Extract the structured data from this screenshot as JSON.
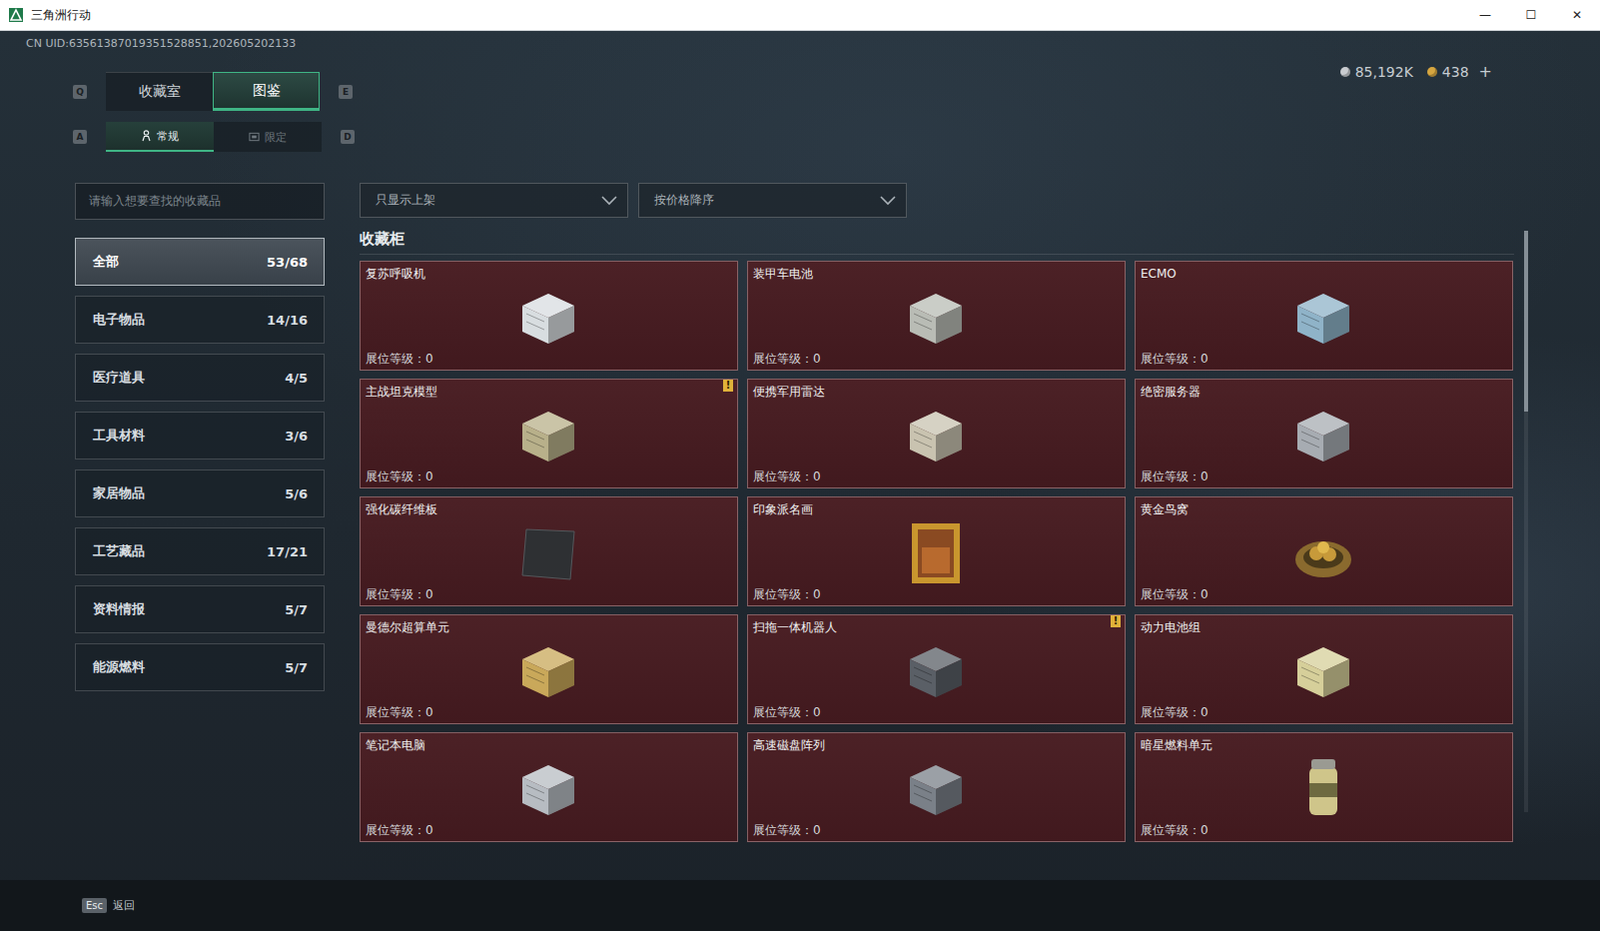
{
  "window": {
    "title": "三角洲行动",
    "controls": [
      "—",
      "☐",
      "✕"
    ]
  },
  "uid": "CN UID:63561387019351528851,202605202133",
  "currency": [
    {
      "amount": "85,192K",
      "color": "#c9ccd0"
    },
    {
      "amount": "438",
      "color": "#d6a640"
    }
  ],
  "add_button": "+",
  "main_tabs": {
    "prev_key": "Q",
    "next_key": "E",
    "tabs": [
      {
        "label": "收藏室",
        "selected": false
      },
      {
        "label": "图鉴",
        "selected": true
      }
    ]
  },
  "sub_tabs": {
    "prev_key": "A",
    "next_key": "D",
    "tabs": [
      {
        "label": "常规",
        "selected": true,
        "kind": "regular"
      },
      {
        "label": "限定",
        "selected": false,
        "kind": "limited"
      }
    ]
  },
  "search": {
    "placeholder": "请输入想要查找的收藏品"
  },
  "filters": [
    {
      "value": "只显示上架"
    },
    {
      "value": "按价格降序"
    }
  ],
  "categories": [
    {
      "label": "全部",
      "count": "53/68",
      "selected": true
    },
    {
      "label": "电子物品",
      "count": "14/16",
      "selected": false
    },
    {
      "label": "医疗道具",
      "count": "4/5",
      "selected": false
    },
    {
      "label": "工具材料",
      "count": "3/6",
      "selected": false
    },
    {
      "label": "家居物品",
      "count": "5/6",
      "selected": false
    },
    {
      "label": "工艺藏品",
      "count": "17/21",
      "selected": false
    },
    {
      "label": "资料情报",
      "count": "5/7",
      "selected": false
    },
    {
      "label": "能源燃料",
      "count": "5/7",
      "selected": false
    }
  ],
  "section_title": "收藏柜",
  "alert_mark": "!",
  "cards": [
    {
      "name": "复苏呼吸机",
      "rank_text": "展位等级：0",
      "alert": false
    },
    {
      "name": "装甲车电池",
      "rank_text": "展位等级：0",
      "alert": false
    },
    {
      "name": "ECMO",
      "rank_text": "展位等级：0",
      "alert": false
    },
    {
      "name": "主战坦克模型",
      "rank_text": "展位等级：0",
      "alert": true
    },
    {
      "name": "便携军用雷达",
      "rank_text": "展位等级：0",
      "alert": false
    },
    {
      "name": "绝密服务器",
      "rank_text": "展位等级：0",
      "alert": false
    },
    {
      "name": "强化碳纤维板",
      "rank_text": "展位等级：0",
      "alert": false
    },
    {
      "name": "印象派名画",
      "rank_text": "展位等级：0",
      "alert": false
    },
    {
      "name": "黄金鸟窝",
      "rank_text": "展位等级：0",
      "alert": false
    },
    {
      "name": "曼德尔超算单元",
      "rank_text": "展位等级：0",
      "alert": false
    },
    {
      "name": "扫拖一体机器人",
      "rank_text": "展位等级：0",
      "alert": true
    },
    {
      "name": "动力电池组",
      "rank_text": "展位等级：0",
      "alert": false
    },
    {
      "name": "笔记本电脑",
      "rank_text": "展位等级：0",
      "alert": false
    },
    {
      "name": "高速磁盘阵列",
      "rank_text": "展位等级：0",
      "alert": false
    },
    {
      "name": "暗星燃料单元",
      "rank_text": "展位等级：0",
      "alert": false
    }
  ],
  "footer": {
    "key": "Esc",
    "label": "返回"
  }
}
